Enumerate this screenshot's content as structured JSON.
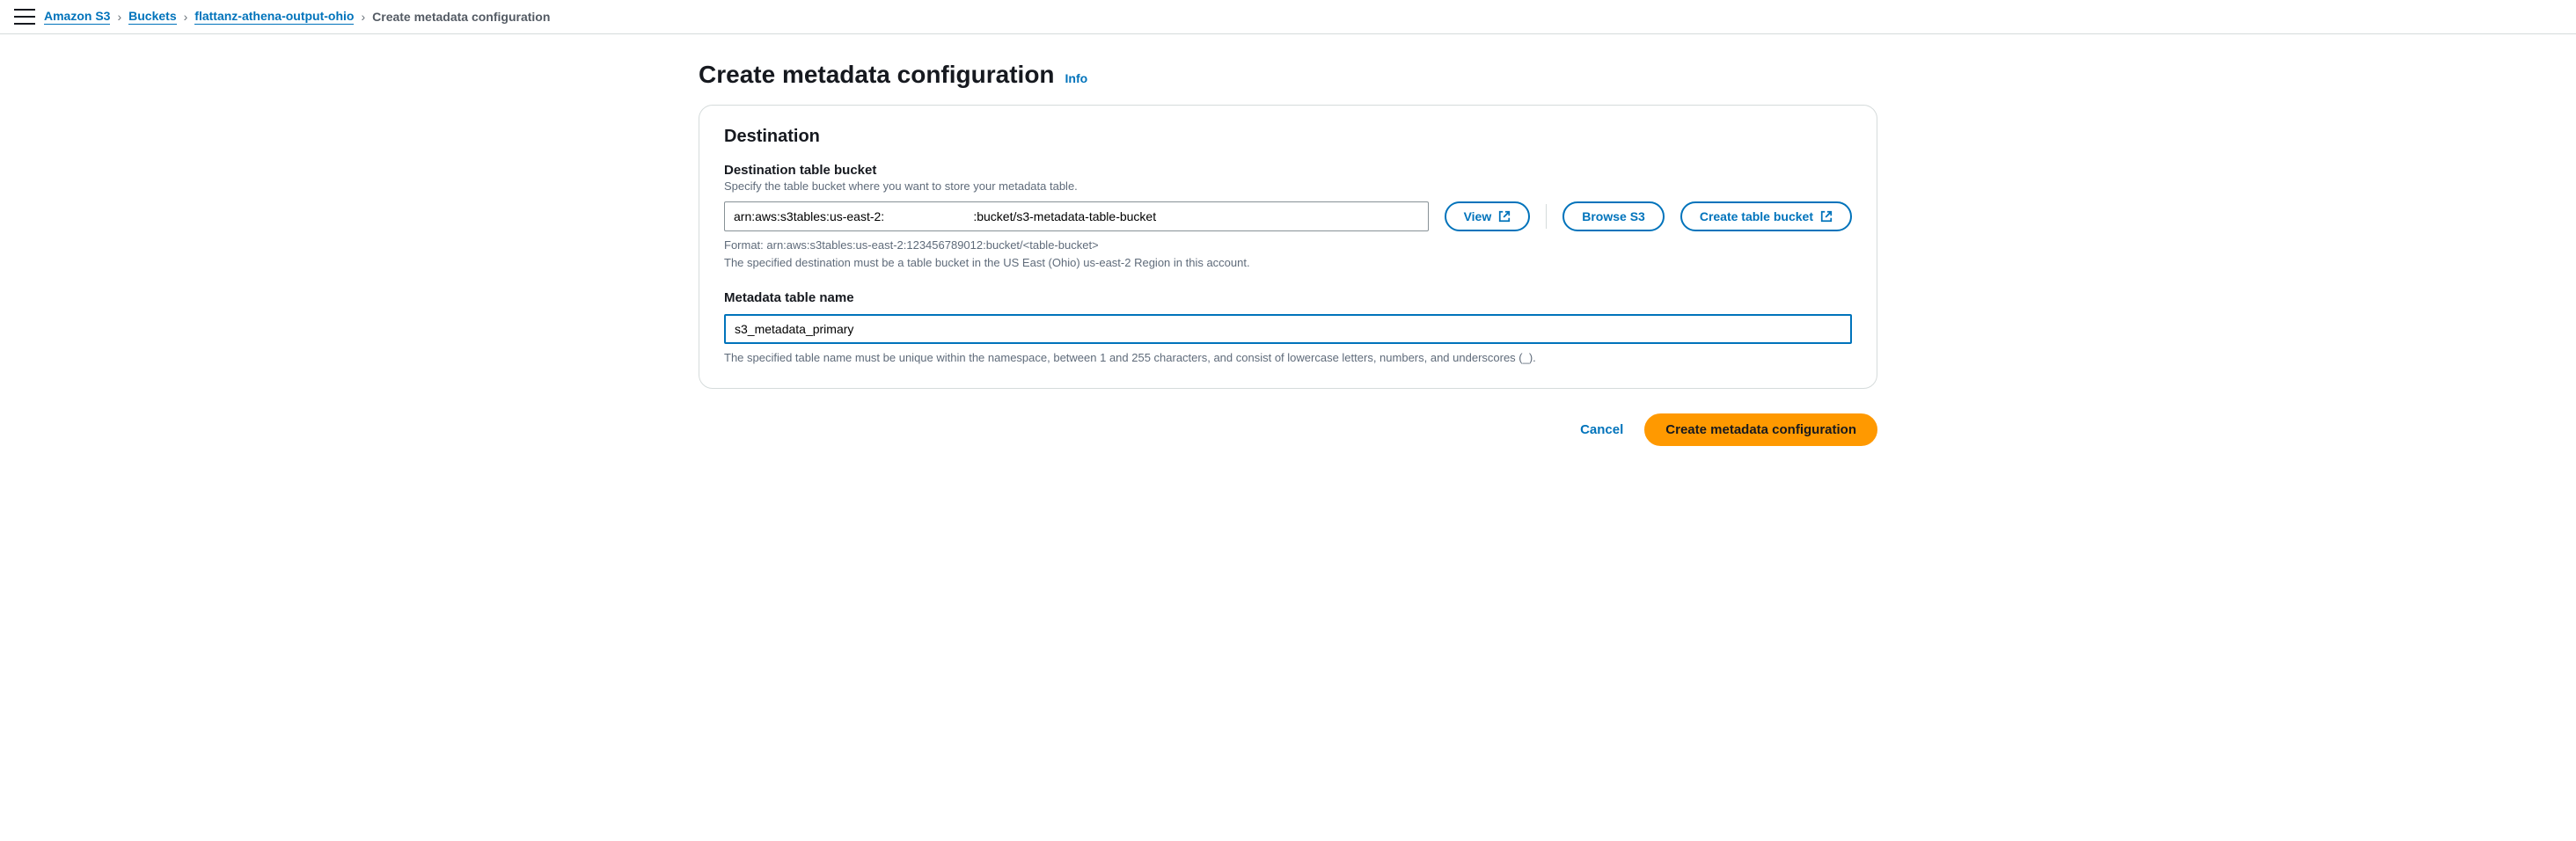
{
  "breadcrumb": {
    "root": "Amazon S3",
    "buckets": "Buckets",
    "bucket_name": "flattanz-athena-output-ohio",
    "current": "Create metadata configuration"
  },
  "page": {
    "title": "Create metadata configuration",
    "info": "Info"
  },
  "panel": {
    "heading": "Destination",
    "dest_label": "Destination table bucket",
    "dest_subtext": "Specify the table bucket where you want to store your metadata table.",
    "dest_value": "arn:aws:s3tables:us-east-2:                          :bucket/s3-metadata-table-bucket",
    "view": "View",
    "browse": "Browse S3",
    "create_bucket": "Create table bucket",
    "dest_hint1": "Format: arn:aws:s3tables:us-east-2:123456789012:bucket/<table-bucket>",
    "dest_hint2": "The specified destination must be a table bucket in the US East (Ohio) us-east-2 Region in this account.",
    "name_label": "Metadata table name",
    "name_value": "s3_metadata_primary",
    "name_hint": "The specified table name must be unique within the namespace, between 1 and 255 characters, and consist of lowercase letters, numbers, and underscores (_)."
  },
  "footer": {
    "cancel": "Cancel",
    "submit": "Create metadata configuration"
  }
}
